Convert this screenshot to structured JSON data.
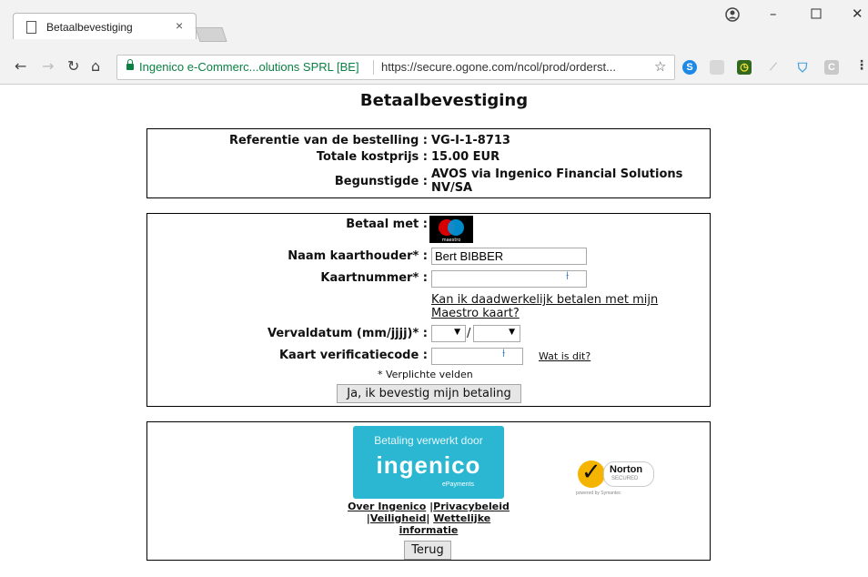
{
  "browser": {
    "tab_title": "Betaalbevestiging",
    "tab_close": "×",
    "secure_label": "Ingenico e-Commerc...olutions SPRL [BE]",
    "url": "https://secure.ogone.com/ncol/prod/orderst..."
  },
  "page": {
    "title": "Betaalbevestiging"
  },
  "order": {
    "ref_label": "Referentie van de bestelling :",
    "ref_value": "VG-I-1-8713",
    "total_label": "Totale kostprijs :",
    "total_value": "15.00 EUR",
    "beneficiary_label": "Begunstigde :",
    "beneficiary_value": "AVOS via Ingenico Financial Solutions NV/SA"
  },
  "payment": {
    "pay_with_label": "Betaal met :",
    "card_brand": "maestro",
    "holder_label": "Naam kaarthouder* :",
    "holder_value": "Bert BIBBER",
    "cardnum_label": "Kaartnummer* :",
    "maestro_link": "Kan ik daadwerkelijk betalen met mijn Maestro kaart?",
    "expiry_label": "Vervaldatum (mm/jjjj)* :",
    "expiry_sep": "/",
    "cvc_label": "Kaart verificatiecode :",
    "cvc_help": "Wat is dit?",
    "required_note": "* Verplichte velden",
    "confirm_button": "Ja, ik bevestig mijn betaling"
  },
  "footer": {
    "ingenico_banner_top": "Betaling verwerkt door",
    "ingenico_banner_logo": "ingenico",
    "ingenico_banner_sub": "ePayments",
    "norton_name": "Norton",
    "norton_secured": "SECURED",
    "norton_powered": "powered by Symantec",
    "link_about": "Over Ingenico",
    "link_privacy": "Privacybeleid",
    "link_security": "Veiligheid",
    "link_legal": "Wettelijke informatie",
    "back_button": "Terug"
  },
  "colors": {
    "ingenico_teal": "#2bb6d1",
    "secure_green": "#0b8043"
  }
}
